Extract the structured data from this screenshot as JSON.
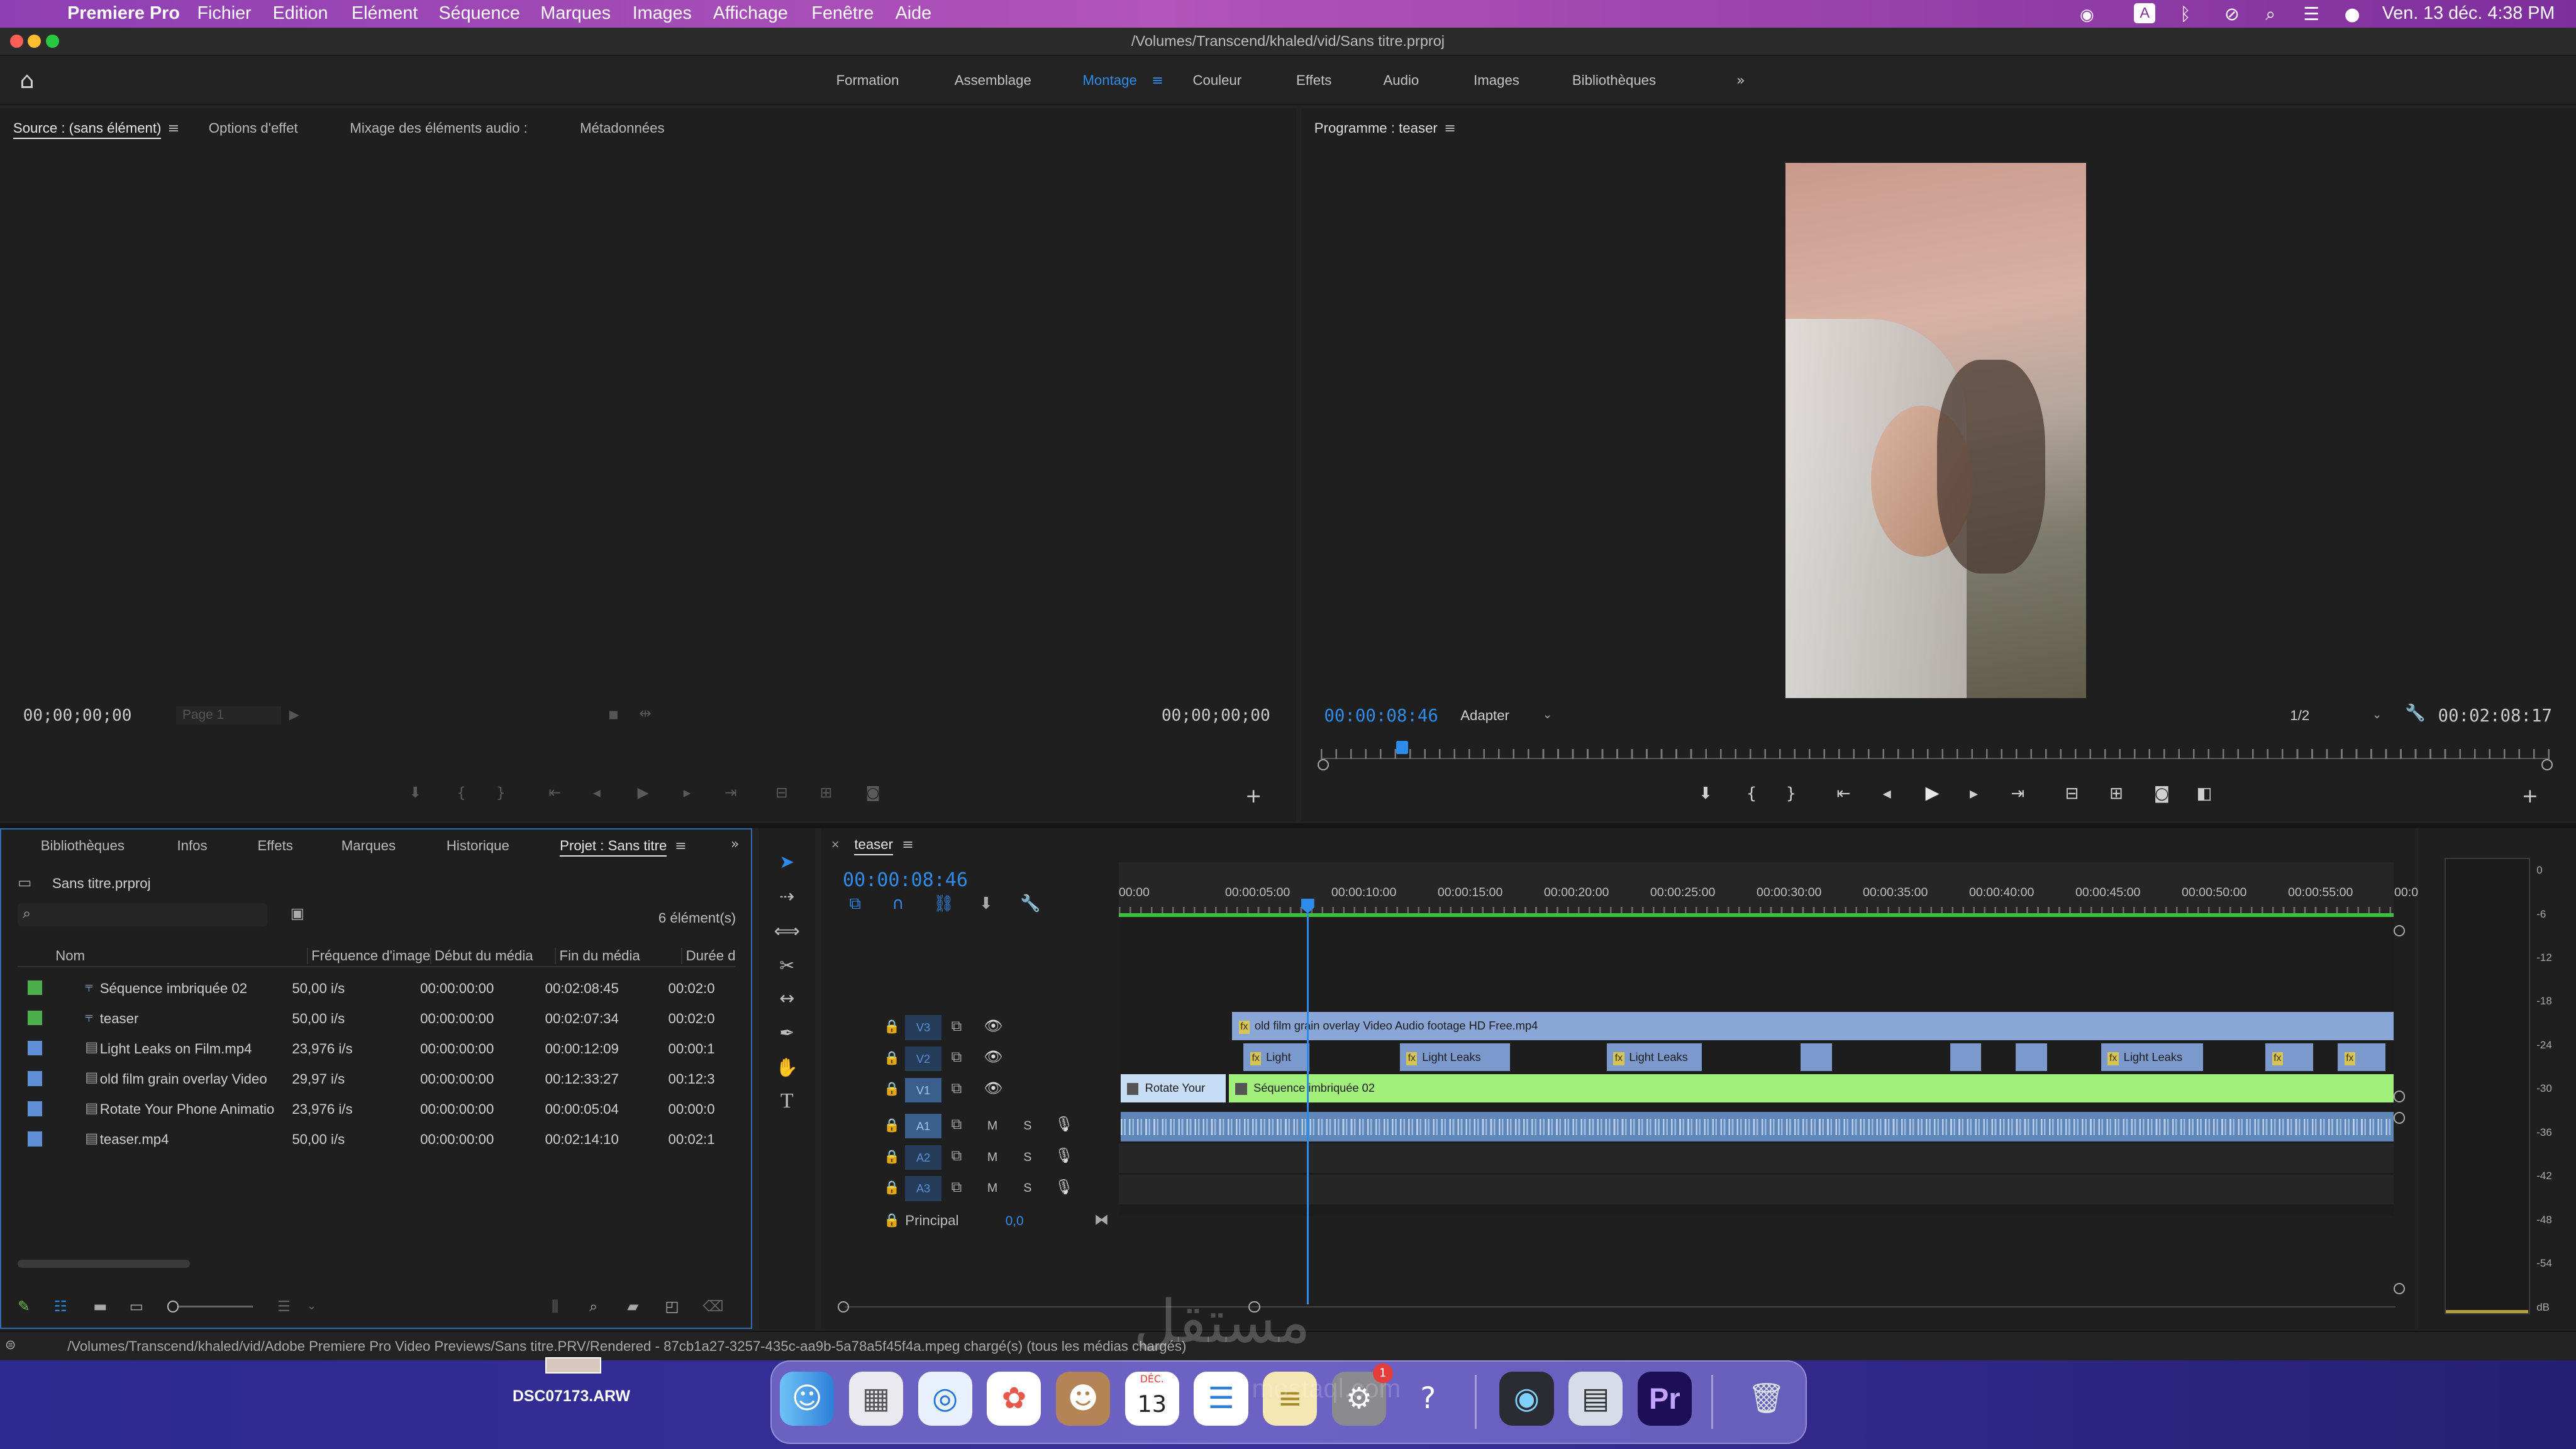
{
  "menubar": {
    "apple": "",
    "app": "Premiere Pro",
    "items": [
      "Fichier",
      "Edition",
      "Elément",
      "Séquence",
      "Marques",
      "Images",
      "Affichage",
      "Fenêtre",
      "Aide"
    ],
    "input_indicator": "A",
    "datetime": "Ven. 13 déc.  4:38 PM"
  },
  "window": {
    "title": "/Volumes/Transcend/khaled/vid/Sans titre.prproj"
  },
  "workspaces": {
    "items": [
      "Formation",
      "Assemblage",
      "Montage",
      "Couleur",
      "Effets",
      "Audio",
      "Images",
      "Bibliothèques"
    ],
    "active": "Montage"
  },
  "source_panel": {
    "tabs": [
      "Source : (sans élément)",
      "Options d'effet",
      "Mixage des éléments audio :",
      "Métadonnées"
    ],
    "timecode_left": "00;00;00;00",
    "timecode_right": "00;00;00;00",
    "page": "Page 1"
  },
  "program_panel": {
    "title": "Programme : teaser",
    "timecode": "00:00:08:46",
    "fit": "Adapter",
    "resolution": "1/2",
    "duration": "00:02:08:17"
  },
  "project_panel": {
    "tabs": [
      "Bibliothèques",
      "Infos",
      "Effets",
      "Marques",
      "Historique",
      "Projet : Sans titre"
    ],
    "file": "Sans titre.prproj",
    "count": "6 élément(s)",
    "columns": [
      "Nom",
      "Fréquence d'image",
      "Début du média",
      "Fin du média",
      "Durée d"
    ],
    "rows": [
      {
        "name": "Séquence imbriquée 02",
        "fps": "50,00 i/s",
        "start": "00:00:00:00",
        "end": "00:02:08:45",
        "dur": "00:02:0",
        "color": "#4cae4c",
        "kind": "seq"
      },
      {
        "name": "teaser",
        "fps": "50,00 i/s",
        "start": "00:00:00:00",
        "end": "00:02:07:34",
        "dur": "00:02:0",
        "color": "#4cae4c",
        "kind": "seq"
      },
      {
        "name": "Light Leaks on Film.mp4",
        "fps": "23,976 i/s",
        "start": "00:00:00:00",
        "end": "00:00:12:09",
        "dur": "00:00:1",
        "color": "#5e8fd6",
        "kind": "vid"
      },
      {
        "name": "old film grain overlay  Video",
        "fps": "29,97 i/s",
        "start": "00:00:00:00",
        "end": "00:12:33:27",
        "dur": "00:12:3",
        "color": "#5e8fd6",
        "kind": "vid"
      },
      {
        "name": "Rotate Your Phone Animatio",
        "fps": "23,976 i/s",
        "start": "00:00:00:00",
        "end": "00:00:05:04",
        "dur": "00:00:0",
        "color": "#5e8fd6",
        "kind": "vid"
      },
      {
        "name": "teaser.mp4",
        "fps": "50,00 i/s",
        "start": "00:00:00:00",
        "end": "00:02:14:10",
        "dur": "00:02:1",
        "color": "#5e8fd6",
        "kind": "vid"
      }
    ]
  },
  "timeline": {
    "tab": "teaser",
    "timecode": "00:00:08:46",
    "ruler": [
      "00:00",
      "00:00:05:00",
      "00:00:10:00",
      "00:00:15:00",
      "00:00:20:00",
      "00:00:25:00",
      "00:00:30:00",
      "00:00:35:00",
      "00:00:40:00",
      "00:00:45:00",
      "00:00:50:00",
      "00:00:55:00",
      "00:01"
    ],
    "video_tracks": [
      "V3",
      "V2",
      "V1"
    ],
    "audio_tracks": [
      "A1",
      "A2",
      "A3"
    ],
    "m_label": "M",
    "s_label": "S",
    "master": {
      "label": "Principal",
      "value": "0,0"
    },
    "clips": {
      "v3": "old film grain overlay  Video Audio footage HD Free.mp4",
      "v2a": "Light",
      "v2b": "Light Leaks",
      "v2c": "Light Leaks",
      "v2d": "Light Leaks",
      "v1a": "Rotate Your",
      "v1b": "Séquence imbriquée 02",
      "fx": "fx"
    }
  },
  "meter": {
    "scale": [
      "0",
      "-6",
      "-12",
      "-18",
      "-24",
      "-30",
      "-36",
      "-42",
      "-48",
      "-54",
      "dB"
    ]
  },
  "statusbar": {
    "text": "/Volumes/Transcend/khaled/vid/Adobe Premiere Pro Video Previews/Sans titre.PRV/Rendered - 87cb1a27-3257-435c-aa9b-5a78a5f45f4a.mpeg chargé(s) (tous les médias chargés)"
  },
  "desktop": {
    "file_label": "DSC07173.ARW"
  },
  "dock": {
    "calendar_month": "DÉC.",
    "calendar_day": "13",
    "badge": "1",
    "premiere_label": "Pr"
  },
  "watermark": {
    "text": "مستقل",
    "sub": "mostaql.com"
  }
}
